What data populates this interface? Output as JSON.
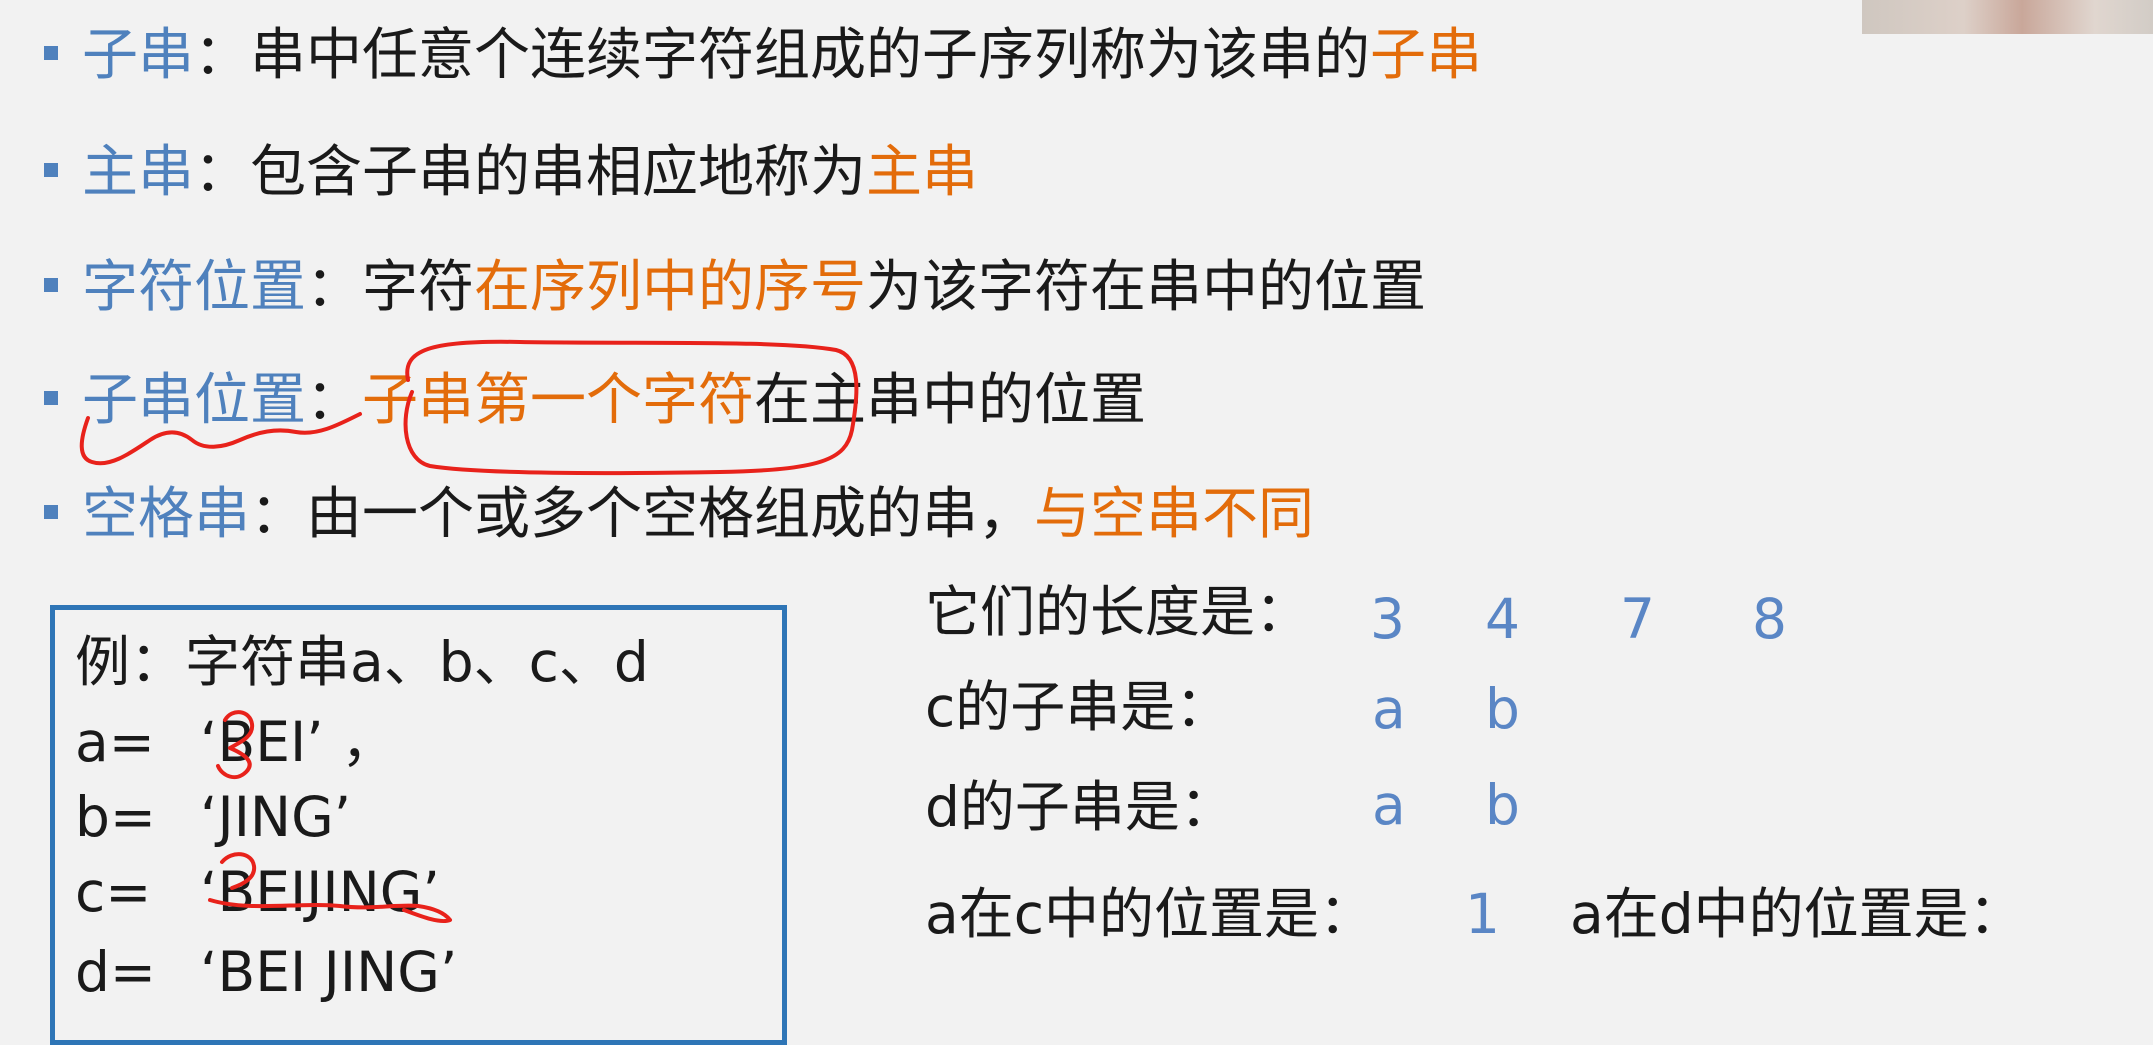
{
  "definitions": [
    {
      "term": "子串",
      "sep": "：",
      "text": "串中任意个连续字符组成的子序列称为该串的",
      "highlight": "子串",
      "tail": ""
    },
    {
      "term": "主串",
      "sep": "：",
      "text": "包含子串的串相应地称为",
      "highlight": "主串",
      "tail": ""
    },
    {
      "term": "字符位置",
      "sep": "：",
      "text": "字符",
      "highlight": "在序列中的序号",
      "tail": "为该字符在串中的位置"
    },
    {
      "term": "子串位置",
      "sep": "：",
      "text": "",
      "highlight": "子串第一个字符",
      "tail": "在主串中的位置"
    },
    {
      "term": "空格串",
      "sep": "：",
      "text": "由一个或多个空格组成的串，",
      "highlight": "与空串不同",
      "tail": ""
    }
  ],
  "example": {
    "title": "例：字符串a、b、c、d",
    "rows": [
      {
        "label": "a=",
        "value": "‘BEI’ ，"
      },
      {
        "label": "b=",
        "value": "‘JING’"
      },
      {
        "label": "c=",
        "value": "‘BEIJING’"
      },
      {
        "label": "d=",
        "value": "‘BEI JING’"
      }
    ]
  },
  "questions": {
    "lengths_label": "它们的长度是：",
    "lengths": [
      "3",
      "4",
      "7",
      "8"
    ],
    "c_sub_label": "c的子串是：",
    "c_sub": [
      "a",
      "b"
    ],
    "d_sub_label": "d的子串是：",
    "d_sub": [
      "a",
      "b"
    ],
    "a_in_c_label": "a在c中的位置是：",
    "a_in_c": "1",
    "a_in_d_label": "a在d中的位置是："
  },
  "colors": {
    "term_blue": "#4f81bd",
    "highlight_orange": "#e36c0a",
    "answer_blue": "#5a86c5",
    "box_border": "#2e75b6",
    "ink_red": "#e8221b"
  }
}
